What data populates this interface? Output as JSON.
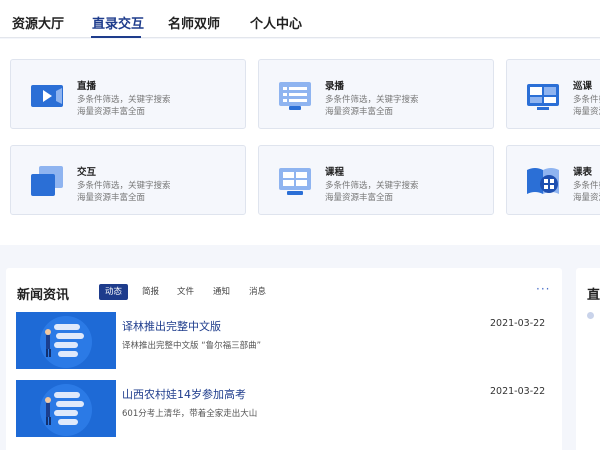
{
  "nav": {
    "items": [
      {
        "label": "资源大厅",
        "active": false
      },
      {
        "label": "直录交互",
        "active": true
      },
      {
        "label": "名师双师",
        "active": false
      },
      {
        "label": "个人中心",
        "active": false
      }
    ]
  },
  "cards": [
    {
      "title": "直播",
      "desc1": "多条件筛选，关键字搜索",
      "desc2": "海量资源丰富全面",
      "icon": "video-camera-icon"
    },
    {
      "title": "录播",
      "desc1": "多条件筛选，关键字搜索",
      "desc2": "海量资源丰富全面",
      "icon": "list-window-icon"
    },
    {
      "title": "巡课",
      "desc1": "多条件筛选，关键字搜索",
      "desc2": "海量资源丰富全面",
      "icon": "monitor-grid-icon"
    },
    {
      "title": "交互",
      "desc1": "多条件筛选，关键字搜索",
      "desc2": "海量资源丰富全面",
      "icon": "stacked-squares-icon"
    },
    {
      "title": "课程",
      "desc1": "多条件筛选，关键字搜索",
      "desc2": "海量资源丰富全面",
      "icon": "course-window-icon"
    },
    {
      "title": "课表",
      "desc1": "多条件筛选，关键字搜索",
      "desc2": "海量资源丰富全面",
      "icon": "book-grid-icon"
    }
  ],
  "news": {
    "title": "新闻资讯",
    "tabs": [
      {
        "label": "动态",
        "active": true
      },
      {
        "label": "简报",
        "active": false
      },
      {
        "label": "文件",
        "active": false
      },
      {
        "label": "通知",
        "active": false
      },
      {
        "label": "消息",
        "active": false
      }
    ],
    "more": "···",
    "items": [
      {
        "title": "译林推出完整中文版",
        "date": "2021-03-22",
        "subtitle": "译林推出完整中文版 “鲁尔福三部曲”"
      },
      {
        "title": "山西农村娃14岁参加高考",
        "date": "2021-03-22",
        "subtitle": "601分考上清华，带着全家走出大山"
      }
    ]
  },
  "right_panel": {
    "title": "直"
  },
  "colors": {
    "accent": "#1e3c8c",
    "icon_blue": "#2b6fd6",
    "icon_light": "#8fb4f0"
  }
}
